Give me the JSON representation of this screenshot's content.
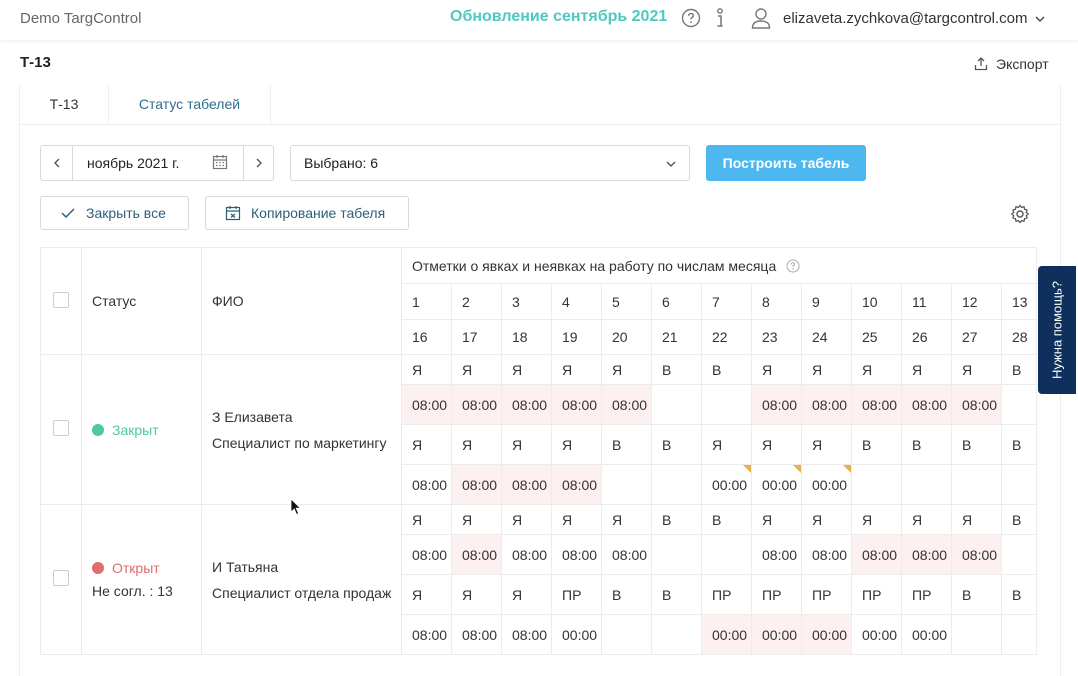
{
  "topbar": {
    "app_name": "Demo TargControl",
    "update_link": "Обновление сентябрь 2021",
    "user_email": "elizaveta.zychkova@targcontrol.com"
  },
  "page": {
    "title": "Т-13",
    "export_label": "Экспорт"
  },
  "tabs": [
    {
      "label": "Т-13"
    },
    {
      "label": "Статус табелей"
    }
  ],
  "controls": {
    "month_value": "ноябрь 2021 г.",
    "selected_label": "Выбрано: 6",
    "build_button": "Построить табель",
    "close_all": "Закрыть все",
    "copy_timesheet": "Копирование табеля"
  },
  "grid": {
    "col_status": "Статус",
    "col_fio": "ФИО",
    "marks_header": "Отметки о явках и неявках на работу по числам месяца",
    "days_row1": [
      "1",
      "2",
      "3",
      "4",
      "5",
      "6",
      "7",
      "8",
      "9",
      "10",
      "11",
      "12",
      "13"
    ],
    "days_row2": [
      "16",
      "17",
      "18",
      "19",
      "20",
      "21",
      "22",
      "23",
      "24",
      "25",
      "26",
      "27",
      "28"
    ],
    "employees": [
      {
        "status": "Закрыт",
        "status_color": "#4fc8a8",
        "status_sub": "",
        "name": "З Елизавета",
        "position": "Специалист по маркетингу",
        "rows": [
          [
            {
              "v": "Я"
            },
            {
              "v": "Я"
            },
            {
              "v": "Я"
            },
            {
              "v": "Я"
            },
            {
              "v": "Я"
            },
            {
              "v": "В",
              "red": true
            },
            {
              "v": "В",
              "red": true
            },
            {
              "v": "Я"
            },
            {
              "v": "Я"
            },
            {
              "v": "Я"
            },
            {
              "v": "Я"
            },
            {
              "v": "Я"
            },
            {
              "v": "В",
              "red": true
            }
          ],
          [
            {
              "v": "08:00",
              "pink": true
            },
            {
              "v": "08:00",
              "pink": true
            },
            {
              "v": "08:00",
              "pink": true
            },
            {
              "v": "08:00",
              "pink": true
            },
            {
              "v": "08:00",
              "pink": true
            },
            {
              "v": ""
            },
            {
              "v": ""
            },
            {
              "v": "08:00",
              "pink": true
            },
            {
              "v": "08:00",
              "pink": true
            },
            {
              "v": "08:00",
              "pink": true
            },
            {
              "v": "08:00",
              "pink": true
            },
            {
              "v": "08:00",
              "pink": true
            },
            {
              "v": ""
            }
          ],
          [
            {
              "v": "Я"
            },
            {
              "v": "Я"
            },
            {
              "v": "Я"
            },
            {
              "v": "Я"
            },
            {
              "v": "В",
              "red": true
            },
            {
              "v": "В",
              "red": true
            },
            {
              "v": "Я"
            },
            {
              "v": "Я"
            },
            {
              "v": "Я"
            },
            {
              "v": "В",
              "red": true
            },
            {
              "v": "В",
              "red": true
            },
            {
              "v": "В",
              "red": true
            },
            {
              "v": "В",
              "red": true
            }
          ],
          [
            {
              "v": "08:00"
            },
            {
              "v": "08:00",
              "pink": true
            },
            {
              "v": "08:00",
              "pink": true
            },
            {
              "v": "08:00",
              "pink": true
            },
            {
              "v": ""
            },
            {
              "v": ""
            },
            {
              "v": "00:00",
              "flag": true
            },
            {
              "v": "00:00",
              "flag": true
            },
            {
              "v": "00:00",
              "flag": true
            },
            {
              "v": ""
            },
            {
              "v": ""
            },
            {
              "v": ""
            },
            {
              "v": ""
            }
          ]
        ]
      },
      {
        "status": "Открыт",
        "status_color": "#e26b6b",
        "status_sub": "Не согл. : 13",
        "name": "И Татьяна",
        "position": "Специалист отдела продаж",
        "rows": [
          [
            {
              "v": "Я"
            },
            {
              "v": "Я"
            },
            {
              "v": "Я"
            },
            {
              "v": "Я"
            },
            {
              "v": "Я"
            },
            {
              "v": "В",
              "red": true
            },
            {
              "v": "В",
              "red": true
            },
            {
              "v": "Я"
            },
            {
              "v": "Я"
            },
            {
              "v": "Я"
            },
            {
              "v": "Я"
            },
            {
              "v": "Я"
            },
            {
              "v": "В",
              "red": true
            }
          ],
          [
            {
              "v": "08:00"
            },
            {
              "v": "08:00",
              "pink": true
            },
            {
              "v": "08:00"
            },
            {
              "v": "08:00"
            },
            {
              "v": "08:00"
            },
            {
              "v": ""
            },
            {
              "v": ""
            },
            {
              "v": "08:00"
            },
            {
              "v": "08:00"
            },
            {
              "v": "08:00",
              "pink": true
            },
            {
              "v": "08:00",
              "pink": true
            },
            {
              "v": "08:00",
              "pink": true
            },
            {
              "v": ""
            }
          ],
          [
            {
              "v": "Я"
            },
            {
              "v": "Я"
            },
            {
              "v": "Я"
            },
            {
              "v": "ПР"
            },
            {
              "v": "В",
              "red": true
            },
            {
              "v": "В",
              "red": true
            },
            {
              "v": "ПР"
            },
            {
              "v": "ПР"
            },
            {
              "v": "ПР"
            },
            {
              "v": "ПР"
            },
            {
              "v": "ПР"
            },
            {
              "v": "В",
              "red": true
            },
            {
              "v": "В",
              "red": true
            }
          ],
          [
            {
              "v": "08:00"
            },
            {
              "v": "08:00"
            },
            {
              "v": "08:00"
            },
            {
              "v": "00:00"
            },
            {
              "v": ""
            },
            {
              "v": ""
            },
            {
              "v": "00:00",
              "pink": true
            },
            {
              "v": "00:00",
              "pink": true
            },
            {
              "v": "00:00",
              "pink": true
            },
            {
              "v": "00:00"
            },
            {
              "v": "00:00"
            },
            {
              "v": ""
            },
            {
              "v": ""
            }
          ]
        ]
      }
    ]
  },
  "help_tab": "Нужна помощь?"
}
